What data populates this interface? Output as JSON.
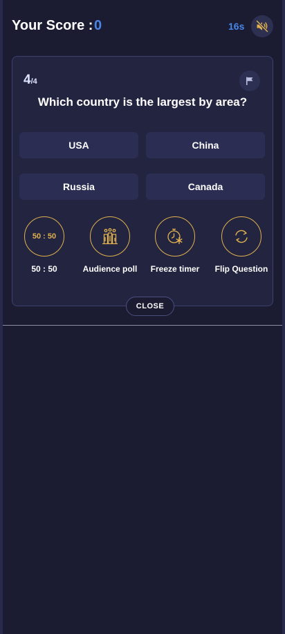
{
  "header": {
    "score_label": "Your Score :",
    "score_value": "0",
    "timer": "16s",
    "mute_icon": "speaker-muted-icon"
  },
  "question": {
    "current": "4",
    "total": "/4",
    "text": "Which country is the largest by area?",
    "flag_icon": "flag-icon"
  },
  "options": [
    {
      "label": "USA"
    },
    {
      "label": "China"
    },
    {
      "label": "Russia"
    },
    {
      "label": "Canada"
    }
  ],
  "lifelines": [
    {
      "ring_text": "50 : 50",
      "label": "50 : 50",
      "icon": "fifty-fifty-icon"
    },
    {
      "ring_text": "",
      "label": "Audience poll",
      "icon": "audience-poll-icon"
    },
    {
      "ring_text": "",
      "label": "Freeze timer",
      "icon": "freeze-timer-icon"
    },
    {
      "ring_text": "",
      "label": "Flip Question",
      "icon": "flip-question-icon"
    }
  ],
  "close_label": "CLOSE",
  "colors": {
    "background": "#1b1c32",
    "accent_blue": "#4a86e8",
    "gold": "#e2b24e",
    "option_bg": "#2b2e52"
  }
}
